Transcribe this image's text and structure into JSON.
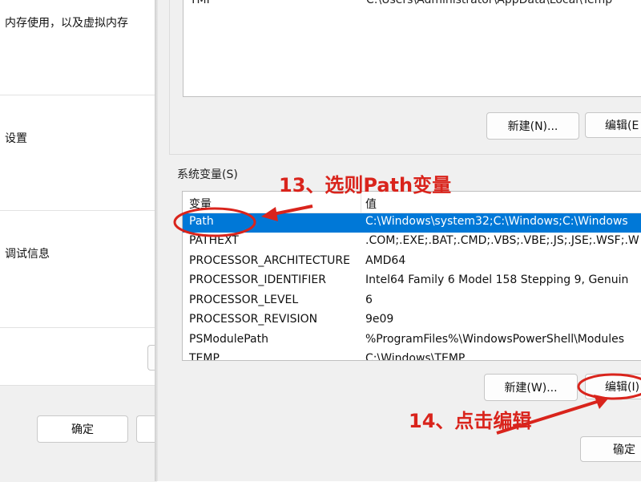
{
  "left_dialog": {
    "line1": "内存使用，以及虚拟内存",
    "line2": "设置",
    "line3": "调试信息",
    "ok_label": "确定"
  },
  "env_dialog": {
    "user_vars": {
      "partial_row": {
        "name": "TMP",
        "value": "C:\\Users\\Administrator\\AppData\\Local\\Temp"
      },
      "new_button": "新建(N)...",
      "edit_button": "编辑(E"
    },
    "system_vars": {
      "label": "系统变量(S)",
      "columns": [
        "变量",
        "值"
      ],
      "rows": [
        {
          "name": "Path",
          "value": "C:\\Windows\\system32;C:\\Windows;C:\\Windows",
          "selected": true
        },
        {
          "name": "PATHEXT",
          "value": ".COM;.EXE;.BAT;.CMD;.VBS;.VBE;.JS;.JSE;.WSF;.W"
        },
        {
          "name": "PROCESSOR_ARCHITECTURE",
          "value": "AMD64"
        },
        {
          "name": "PROCESSOR_IDENTIFIER",
          "value": "Intel64 Family 6 Model 158 Stepping 9, Genuin"
        },
        {
          "name": "PROCESSOR_LEVEL",
          "value": "6"
        },
        {
          "name": "PROCESSOR_REVISION",
          "value": "9e09"
        },
        {
          "name": "PSModulePath",
          "value": "%ProgramFiles%\\WindowsPowerShell\\Modules"
        },
        {
          "name": "TEMP",
          "value": "C:\\Windows\\TEMP"
        }
      ],
      "new_button": "新建(W)...",
      "edit_button": "编辑(I)"
    },
    "ok_partial": "确定"
  },
  "annotations": {
    "step13": "13、选则Path变量",
    "step14": "14、点击编辑",
    "color": "#d9241c"
  },
  "colors": {
    "selection": "#0078d7",
    "dialog_bg": "#f0f0f0"
  }
}
